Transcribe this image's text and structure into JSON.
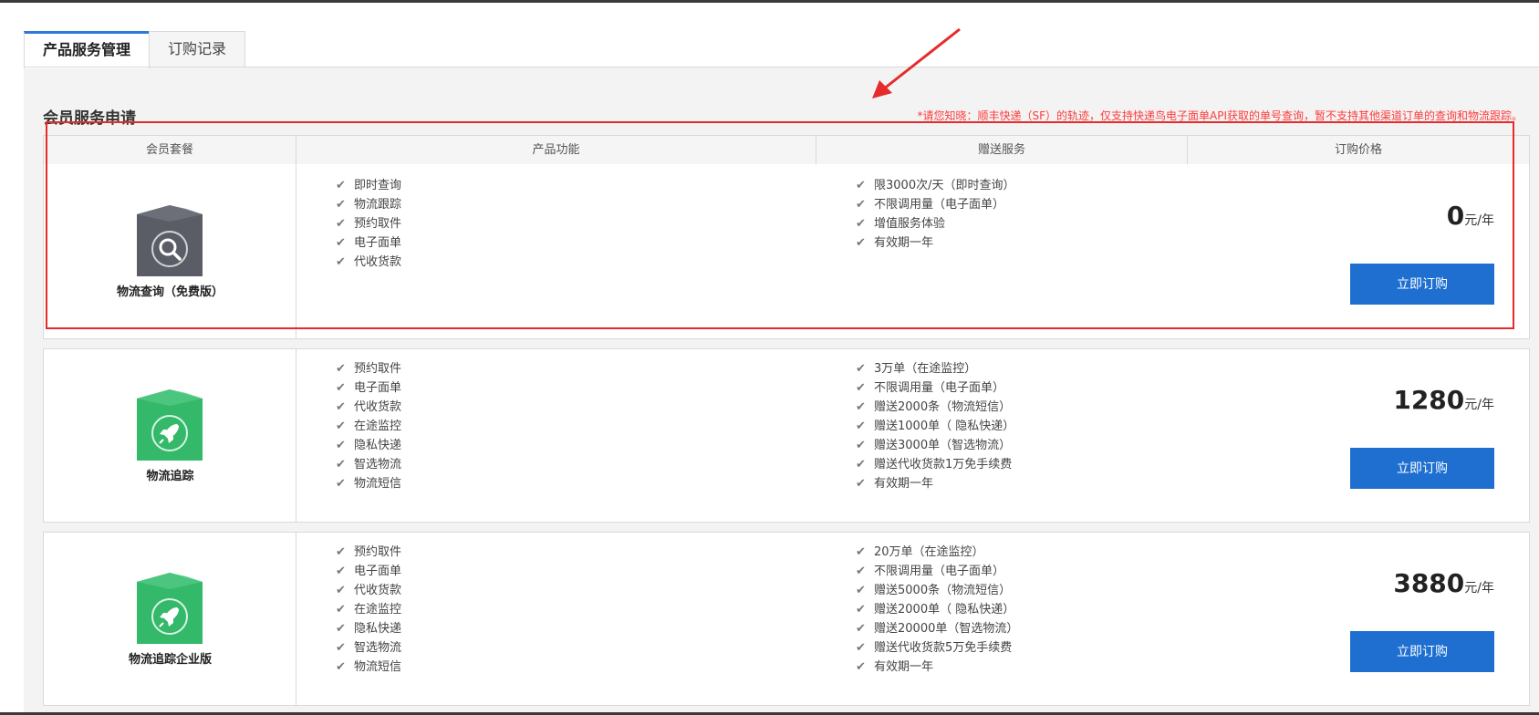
{
  "tabs": [
    {
      "label": "产品服务管理",
      "active": true
    },
    {
      "label": "订购记录",
      "active": false
    }
  ],
  "section_title": "会员服务申请",
  "notice": "*请您知晓：顺丰快递（SF）的轨迹，仅支持快递鸟电子面单API获取的单号查询，暂不支持其他渠道订单的查询和物流跟踪。",
  "table": {
    "headers": [
      "会员套餐",
      "产品功能",
      "赠送服务",
      "订购价格"
    ]
  },
  "plans": [
    {
      "name": "物流查询（免费版）",
      "icon": "search-icon",
      "icon_color": "#5a5d66",
      "features": [
        "即时查询",
        "物流跟踪",
        "预约取件",
        "电子面单",
        "代收货款"
      ],
      "gifts": [
        "限3000次/天（即时查询）",
        "不限调用量（电子面单）",
        "增值服务体验",
        "有效期一年"
      ],
      "price": "0",
      "unit": "元/年",
      "button": "立即订购"
    },
    {
      "name": "物流追踪",
      "icon": "rocket-icon",
      "icon_color": "#34b86a",
      "features": [
        "预约取件",
        "电子面单",
        "代收货款",
        "在途监控",
        "隐私快递",
        "智选物流",
        "物流短信"
      ],
      "gifts": [
        "3万单（在途监控）",
        "不限调用量（电子面单）",
        "赠送2000条（物流短信）",
        "赠送1000单（ 隐私快递）",
        "赠送3000单（智选物流）",
        "赠送代收货款1万免手续费",
        "有效期一年"
      ],
      "price": "1280",
      "unit": "元/年",
      "button": "立即订购"
    },
    {
      "name": "物流追踪企业版",
      "icon": "rocket-icon",
      "icon_color": "#34b86a",
      "features": [
        "预约取件",
        "电子面单",
        "代收货款",
        "在途监控",
        "隐私快递",
        "智选物流",
        "物流短信"
      ],
      "gifts": [
        "20万单（在途监控）",
        "不限调用量（电子面单）",
        "赠送5000条（物流短信）",
        "赠送2000单（ 隐私快递）",
        "赠送20000单（智选物流）",
        "赠送代收货款5万免手续费",
        "有效期一年"
      ],
      "price": "3880",
      "unit": "元/年",
      "button": "立即订购"
    }
  ],
  "accent_color": "#1e6fd0",
  "highlight_color": "#e52b2b"
}
